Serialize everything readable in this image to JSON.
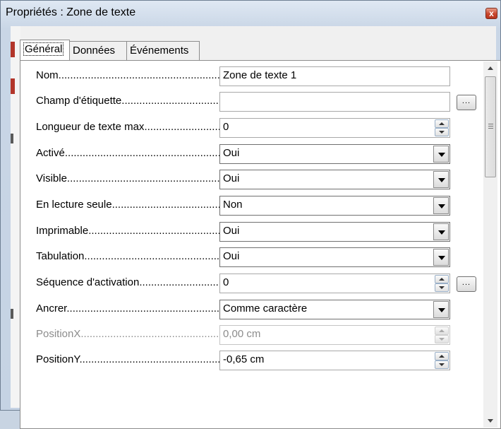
{
  "window": {
    "title": "Propriétés : Zone de texte",
    "close_label": "x",
    "colors": {
      "title_bar": "#c9d6e6",
      "close_button": "#c8452c"
    }
  },
  "tabs": [
    {
      "label": "Général",
      "active": true
    },
    {
      "label": "Données",
      "active": false
    },
    {
      "label": "Événements",
      "active": false
    }
  ],
  "properties": [
    {
      "label": "Nom",
      "value": "Zone de texte 1",
      "control": "text"
    },
    {
      "label": "Champ d'étiquette",
      "value": "",
      "control": "text",
      "ellipsis": true
    },
    {
      "label": "Longueur de texte max",
      "value": "0",
      "control": "spin"
    },
    {
      "label": "Activé",
      "value": "Oui",
      "control": "dropdown"
    },
    {
      "label": "Visible",
      "value": "Oui",
      "control": "dropdown"
    },
    {
      "label": "En lecture seule",
      "value": "Non",
      "control": "dropdown"
    },
    {
      "label": "Imprimable",
      "value": "Oui",
      "control": "dropdown"
    },
    {
      "label": "Tabulation",
      "value": "Oui",
      "control": "dropdown"
    },
    {
      "label": "Séquence d'activation",
      "value": "0",
      "control": "spin",
      "ellipsis": true
    },
    {
      "label": "Ancrer",
      "value": "Comme caractère",
      "control": "dropdown"
    },
    {
      "label": "PositionX",
      "value": "0,00 cm",
      "control": "spin",
      "disabled": true
    },
    {
      "label": "PositionY",
      "value": "-0,65 cm",
      "control": "spin"
    }
  ],
  "ellipsis_label": "...",
  "label_leader": "........................................................................................"
}
